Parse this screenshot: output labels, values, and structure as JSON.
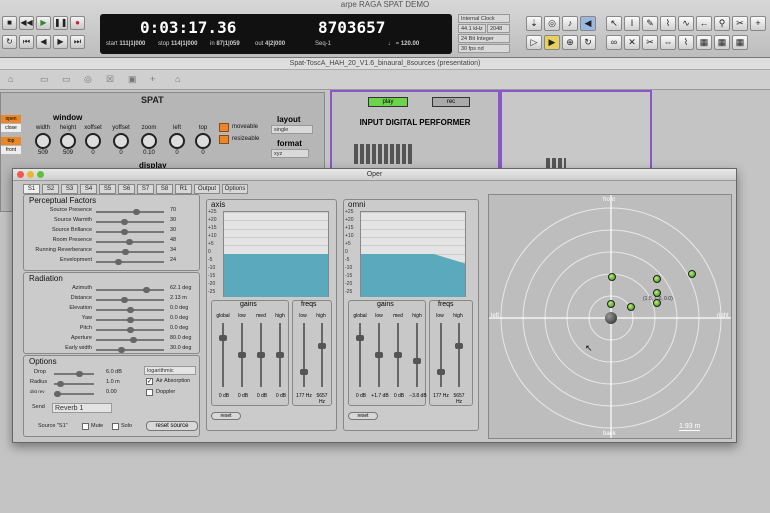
{
  "app_title": "arpe RAGA SPAT DEMO",
  "transport": {
    "main_counter": "0:03:17.36",
    "sub_counter": "8703657",
    "start_label": "start",
    "start_value": "111|1|000",
    "stop_label": "stop",
    "stop_value": "114|1|000",
    "in_label": "in",
    "in_value": "87|1|059",
    "out_label": "out",
    "out_value": "4|2|000",
    "seq_label": "Seq-1",
    "tempo": "120.00",
    "clock": "Internal Clock",
    "rate": "44.1 kHz",
    "buffer": "2048",
    "bit": "24 Bit Integer",
    "fps": "30 fps nd"
  },
  "document_title": "Spat-ToscA_HAH_20_V1.6_binaural_8sources (presentation)",
  "spat_panel": {
    "title": "SPAT",
    "open": "open",
    "close": "close",
    "top": "top",
    "front": "front",
    "window": "window",
    "knobs": [
      {
        "label": "width",
        "value": "509"
      },
      {
        "label": "height",
        "value": "509"
      },
      {
        "label": "xoffset",
        "value": "0"
      },
      {
        "label": "yoffset",
        "value": "0"
      },
      {
        "label": "zoom",
        "value": "0.10"
      },
      {
        "label": "left",
        "value": "0"
      },
      {
        "label": "top",
        "value": "0"
      }
    ],
    "moveable": "moveable",
    "resizeable": "resizeable",
    "layout_label": "layout",
    "layout_value": "single",
    "format_label": "format",
    "format_value": "xyz",
    "display": "display"
  },
  "input_panel": {
    "play": "play",
    "rec": "rec",
    "title": "INPUT DIGITAL PERFORMER"
  },
  "oper": {
    "title": "Oper",
    "tabs": [
      "S1",
      "S2",
      "S3",
      "S4",
      "S5",
      "S6",
      "S7",
      "S8",
      "R1",
      "Output",
      "Options"
    ],
    "perceptual": {
      "title": "Perceptual Factors",
      "rows": [
        {
          "label": "Source Presence",
          "value": "70",
          "pos": 0.6
        },
        {
          "label": "Source Warmth",
          "value": "30",
          "pos": 0.4
        },
        {
          "label": "Source Brillance",
          "value": "30",
          "pos": 0.4
        },
        {
          "label": "Room Presence",
          "value": "48",
          "pos": 0.48
        },
        {
          "label": "Running Reverberance",
          "value": "34",
          "pos": 0.42
        },
        {
          "label": "Envelopment",
          "value": "24",
          "pos": 0.3
        }
      ]
    },
    "radiation": {
      "title": "Radiation",
      "rows": [
        {
          "label": "Azimuth",
          "value": "62.1 deg",
          "pos": 0.75
        },
        {
          "label": "Distance",
          "value": "2.13 m",
          "pos": 0.4
        },
        {
          "label": "Elevation",
          "value": "0.0 deg",
          "pos": 0.5
        },
        {
          "label": "Yaw",
          "value": "0.0 deg",
          "pos": 0.5
        },
        {
          "label": "Pitch",
          "value": "0.0 deg",
          "pos": 0.5
        },
        {
          "label": "Aperture",
          "value": "80.0 deg",
          "pos": 0.55
        },
        {
          "label": "Early width",
          "value": "30.0 deg",
          "pos": 0.35
        }
      ]
    },
    "options": {
      "title": "Options",
      "drop_label": "Drop",
      "drop_value": "6.0 dB",
      "radius_label": "Radius",
      "radius_value": "1.0 m",
      "dist_label": "dist rev",
      "dist_value": "0.00",
      "mode": "logarithmic",
      "air": "Air Absorption",
      "doppler": "Doppler",
      "send_label": "Send",
      "send_value": "Reverb 1",
      "source_label": "Source \"S1\"",
      "mute": "Mute",
      "solo": "Solo",
      "reset_source": "reset source"
    },
    "axis": {
      "title": "axis"
    },
    "omni": {
      "title": "omni"
    },
    "db_scale": [
      "+25",
      "+20",
      "+15",
      "+10",
      "+5",
      "0",
      "-5",
      "-10",
      "-15",
      "-20",
      "-25"
    ],
    "gains_label": "gains",
    "freqs_label": "freqs",
    "gain_cols": [
      "global",
      "low",
      "med",
      "high"
    ],
    "freq_cols": [
      "low",
      "high"
    ],
    "axis_gains": [
      "0 dB",
      "0 dB",
      "0 dB",
      "0 dB"
    ],
    "axis_freqs": [
      "177 Hz",
      "5657 Hz"
    ],
    "omni_gains": [
      "0 dB",
      "+1.7 dB",
      "0 dB",
      "−3.8 dB"
    ],
    "omni_freqs": [
      "177 Hz",
      "5657 Hz"
    ],
    "reset": "reset",
    "radar": {
      "front": "front",
      "back": "back",
      "left": "left",
      "right": "right",
      "scale": "1.93 m",
      "coord": "(1.5, 1.0, 0.0)"
    }
  }
}
